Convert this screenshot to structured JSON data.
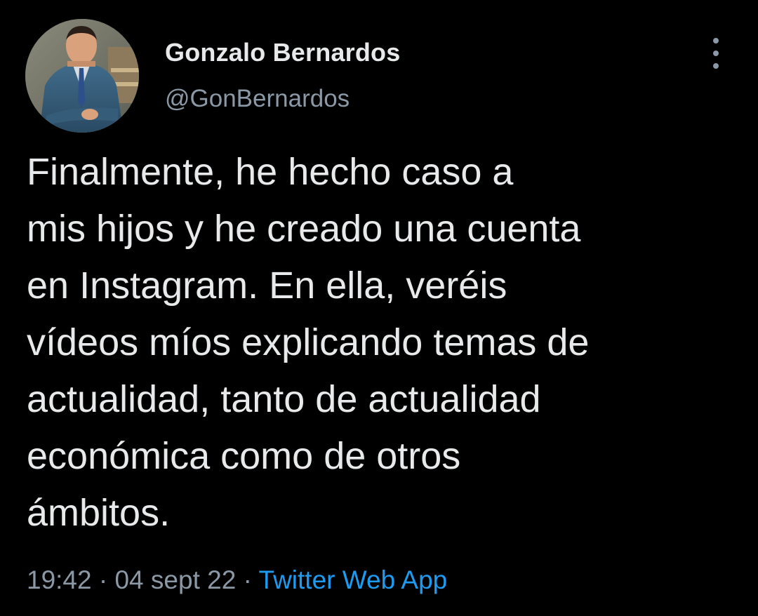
{
  "author": {
    "display_name": "Gonzalo Bernardos",
    "handle": "@GonBernardos"
  },
  "tweet": {
    "text_lines": [
      "Finalmente, he hecho caso a",
      "mis hijos y he creado una cuenta",
      "en Instagram. En ella, veréis",
      "vídeos míos explicando temas de",
      "actualidad, tanto de actualidad",
      "económica como de otros",
      "ámbitos."
    ],
    "time": "19:42",
    "date": "04 sept 22",
    "separator": "·",
    "source": "Twitter Web App"
  },
  "icons": {
    "more": "more-vertical-icon",
    "avatar": "profile-photo"
  },
  "colors": {
    "background": "#000000",
    "primary_text": "#e7e9ea",
    "secondary_text": "#8b98a5",
    "link": "#1d9bf0"
  }
}
